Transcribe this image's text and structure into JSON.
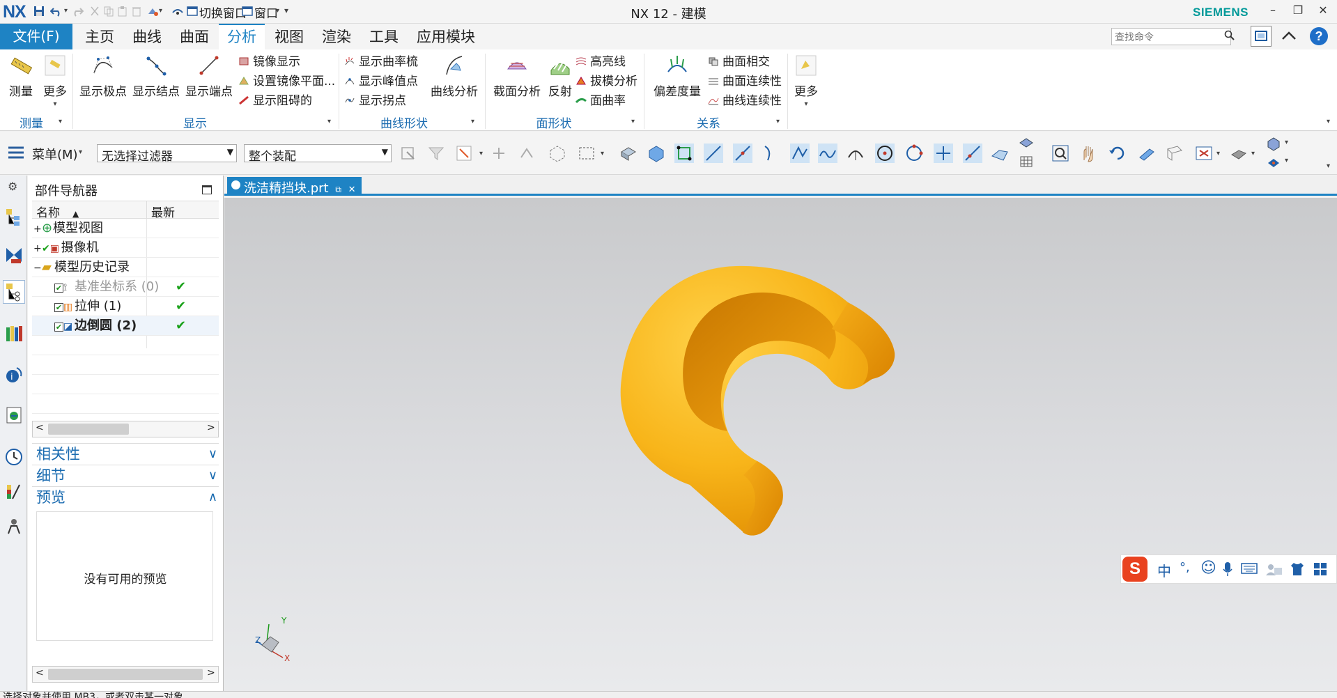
{
  "titlebar": {
    "logo": "NX",
    "quick_switch_window": "切换窗口",
    "quick_window": "窗口",
    "title": "NX 12 - 建模",
    "brand": "SIEMENS",
    "minimize": "–",
    "restore": "❐",
    "close": "✕"
  },
  "menu": {
    "file": "文件(F)",
    "tabs": [
      "主页",
      "曲线",
      "曲面",
      "分析",
      "视图",
      "渲染",
      "工具",
      "应用模块"
    ],
    "active_tab": "分析",
    "search_placeholder": "查找命令"
  },
  "ribbon": {
    "measure": {
      "items": [
        "测量",
        "更多"
      ],
      "label": "测量"
    },
    "display": {
      "big": [
        "显示极点",
        "显示结点",
        "显示端点"
      ],
      "small": [
        "镜像显示",
        "设置镜像平面...",
        "显示阻碍的"
      ],
      "label": "显示"
    },
    "curve_shape": {
      "small": [
        "显示曲率梳",
        "显示峰值点",
        "显示拐点"
      ],
      "big": [
        "曲线分析"
      ],
      "label": "曲线形状"
    },
    "face_shape": {
      "big": [
        "截面分析",
        "反射"
      ],
      "small": [
        "高亮线",
        "拔模分析",
        "面曲率"
      ],
      "label": "面形状"
    },
    "relation": {
      "big": [
        "偏差度量"
      ],
      "small": [
        "曲面相交",
        "曲面连续性",
        "曲线连续性"
      ],
      "label": "关系"
    },
    "more": "更多"
  },
  "toolbar": {
    "menu_button": "菜单(M)",
    "filter": "无选择过滤器",
    "scope": "整个装配"
  },
  "navigator": {
    "title": "部件导航器",
    "col_name": "名称",
    "col_latest": "最新",
    "rows": [
      {
        "label": "模型视图",
        "expander": "+",
        "latest": ""
      },
      {
        "label": "摄像机",
        "expander": "+",
        "latest": ""
      },
      {
        "label": "模型历史记录",
        "expander": "−",
        "latest": ""
      },
      {
        "label": "基准坐标系 (0)",
        "expander": "",
        "latest": "✔"
      },
      {
        "label": "拉伸 (1)",
        "expander": "",
        "latest": "✔"
      },
      {
        "label": "边倒圆 (2)",
        "expander": "",
        "latest": "✔"
      }
    ],
    "sections": {
      "dependencies": "相关性",
      "details": "细节",
      "preview": "预览"
    },
    "preview_empty": "没有可用的预览"
  },
  "document": {
    "tab_label": "洗洁精挡块.prt",
    "tab_close": "✕"
  },
  "triad": {
    "x": "X",
    "y": "Y",
    "z": "Z"
  },
  "ime": {
    "mode": "中",
    "punct": "°,"
  },
  "status": {
    "text": "选择对象并使用 MB3，或者双击某一对象"
  },
  "colors": {
    "accent": "#1e83c4",
    "part": "#f6b81c",
    "brand": "#009999"
  }
}
